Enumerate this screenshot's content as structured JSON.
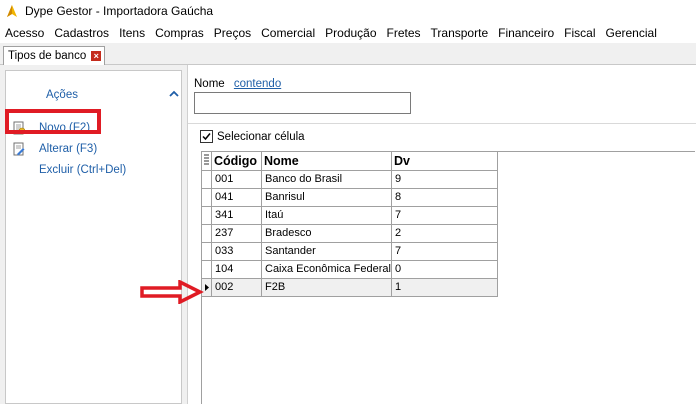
{
  "window": {
    "title": "Dype Gestor - Importadora Gaúcha"
  },
  "menu": [
    "Acesso",
    "Cadastros",
    "Itens",
    "Compras",
    "Preços",
    "Comercial",
    "Produção",
    "Fretes",
    "Transporte",
    "Financeiro",
    "Fiscal",
    "Gerencial"
  ],
  "tab": {
    "label": "Tipos de banco",
    "close_glyph": "×"
  },
  "actions": {
    "title": "Ações",
    "items": [
      {
        "label": "Novo (F2)"
      },
      {
        "label": "Alterar (F3)"
      },
      {
        "label": "Excluir (Ctrl+Del)"
      }
    ]
  },
  "filter": {
    "label": "Nome",
    "mode": "contendo",
    "value": ""
  },
  "select_cell": {
    "label": "Selecionar célula",
    "checked": true
  },
  "grid": {
    "headers": [
      "Código",
      "Nome",
      "Dv"
    ],
    "rows": [
      [
        "001",
        "Banco do Brasil",
        "9"
      ],
      [
        "041",
        "Banrisul",
        "8"
      ],
      [
        "341",
        "Itaú",
        "7"
      ],
      [
        "237",
        "Bradesco",
        "2"
      ],
      [
        "033",
        "Santander",
        "7"
      ],
      [
        "104",
        "Caixa Econômica Federal",
        "0"
      ],
      [
        "002",
        "F2B",
        "1"
      ]
    ],
    "selected_row": 6
  },
  "colors": {
    "accent": "#1f5fa8",
    "annotation": "#e01b24"
  }
}
